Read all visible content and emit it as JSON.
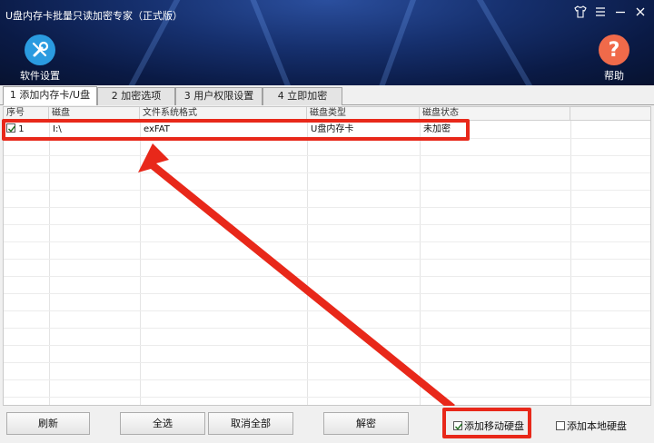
{
  "window": {
    "title": "U盘内存卡批量只读加密专家（正式版）"
  },
  "toolbar": {
    "settings_label": "软件设置",
    "help_label": "帮助",
    "help_glyph": "?"
  },
  "tabs": [
    {
      "label": "1 添加内存卡/U盘",
      "active": true
    },
    {
      "label": "2 加密选项",
      "active": false
    },
    {
      "label": "3 用户权限设置",
      "active": false
    },
    {
      "label": "4 立即加密",
      "active": false
    }
  ],
  "table": {
    "columns": [
      "序号",
      "磁盘",
      "文件系统格式",
      "磁盘类型",
      "磁盘状态"
    ],
    "rows": [
      {
        "checked": true,
        "index": "1",
        "disk": "I:\\",
        "fs": "exFAT",
        "type": "U盘内存卡",
        "status": "未加密"
      }
    ]
  },
  "buttons": {
    "refresh": "刷新",
    "select_all": "全选",
    "deselect_all": "取消全部",
    "decrypt": "解密"
  },
  "options": {
    "add_removable": {
      "label": "添加移动硬盘",
      "checked": true
    },
    "add_local": {
      "label": "添加本地硬盘",
      "checked": false
    }
  },
  "colors": {
    "highlight": "#e8281a",
    "settings_icon_bg": "#2a9be0",
    "help_icon_bg": "#f06a4a"
  }
}
